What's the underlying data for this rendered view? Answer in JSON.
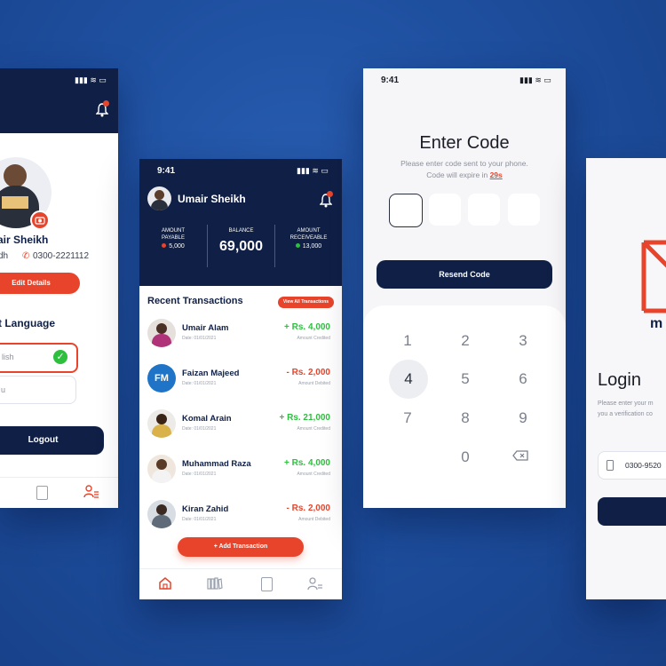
{
  "profile": {
    "name": "air Sheikh",
    "location": "dh",
    "phone": "0300-2221112",
    "edit_button": "Edit Details",
    "language_heading": "t Language",
    "option_english": "lish",
    "option_urdu": "u",
    "logout": "Logout"
  },
  "dashboard": {
    "time": "9:41",
    "user_name": "Umair Sheikh",
    "stats": [
      {
        "label": "AMOUNT\nPAYABLE",
        "value": "5,000"
      },
      {
        "label": "BALANCE",
        "value": "69,000"
      },
      {
        "label": "AMOUNT\nRECEIVEABLE",
        "value": "13,000"
      }
    ],
    "section_title": "Recent Transactions",
    "view_all": "View All Transactions",
    "transactions": [
      {
        "name": "Umair Alam",
        "date": "Date: 01/01/2021",
        "amount": "+ Rs. 4,000",
        "status": "Amount Credited",
        "kind": "credit"
      },
      {
        "name": "Faizan Majeed",
        "date": "Date: 01/01/2021",
        "amount": "- Rs. 2,000",
        "status": "Amount Debited",
        "kind": "debit",
        "initials": "FM"
      },
      {
        "name": "Komal Arain",
        "date": "Date: 01/01/2021",
        "amount": "+ Rs. 21,000",
        "status": "Amount Credited",
        "kind": "credit"
      },
      {
        "name": "Muhammad Raza",
        "date": "Date: 01/01/2021",
        "amount": "+ Rs. 4,000",
        "status": "Amount Credited",
        "kind": "credit"
      },
      {
        "name": "Kiran Zahid",
        "date": "Date: 01/01/2021",
        "amount": "- Rs. 2,000",
        "status": "Amount Debited",
        "kind": "debit"
      }
    ],
    "add_button": "+ Add Transaction"
  },
  "code": {
    "time": "9:41",
    "title": "Enter Code",
    "subtitle": "Please enter code sent to your phone.",
    "expire_prefix": "Code will expire in ",
    "expire_value": "29s",
    "resend": "Resend Code",
    "keys": [
      "1",
      "2",
      "3",
      "4",
      "5",
      "6",
      "7",
      "8",
      "9",
      "0"
    ]
  },
  "login": {
    "brand": "m",
    "title": "Login",
    "line1": "Please enter your m",
    "line2": "you a verification co",
    "phone_value": "0300-9520"
  },
  "colors": {
    "navy": "#0f1f45",
    "red": "#e8442b",
    "green": "#2fbf3f",
    "background": "#1e4f9f"
  }
}
